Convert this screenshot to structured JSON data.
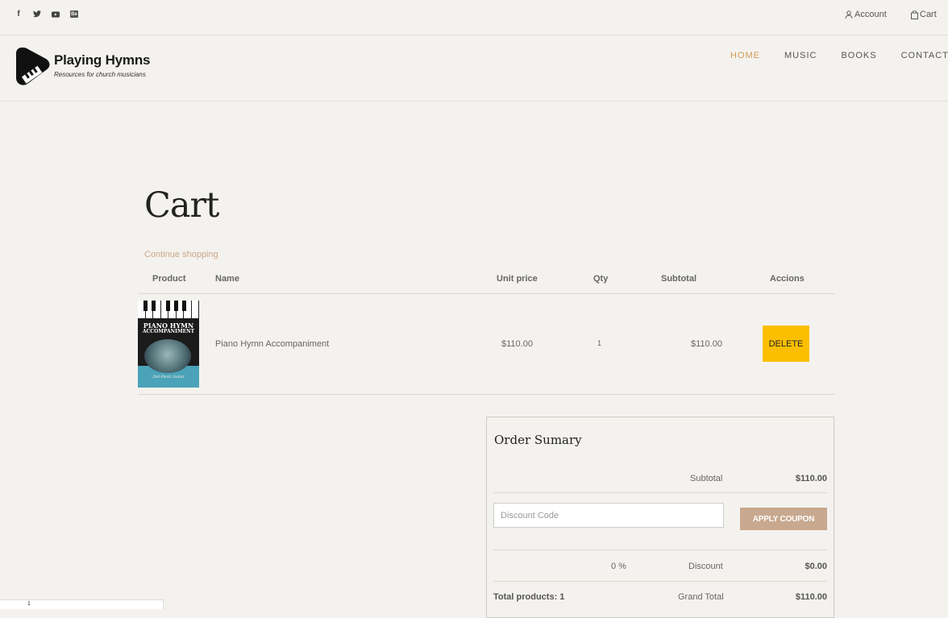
{
  "topbar": {
    "social": [
      "facebook-icon",
      "twitter-icon",
      "youtube-icon",
      "behance-icon"
    ],
    "behance_text": "Be",
    "account_label": "Account",
    "cart_label": "Cart"
  },
  "header": {
    "logo_title": "Playing Hymns",
    "logo_subtitle": "Resources for church musicians",
    "nav": [
      {
        "label": "HOME",
        "active": true
      },
      {
        "label": "MUSIC",
        "active": false
      },
      {
        "label": "BOOKS",
        "active": false
      },
      {
        "label": "CONTACT",
        "active": false
      }
    ],
    "accent_color": "#d29a55"
  },
  "page": {
    "title": "Cart",
    "continue_label": "Continue shopping"
  },
  "table": {
    "headers": [
      "Product",
      "Name",
      "Unit price",
      "Qty",
      "Subtotal",
      "Accions"
    ],
    "items": [
      {
        "cover_title_1": "PIANO HYMN",
        "cover_title_2": "ACCOMPANIMENT",
        "cover_author": "Joel Alevis Juarez",
        "name": "Piano Hymn Accompaniment",
        "unit_price": "$110.00",
        "qty": "1",
        "subtotal": "$110.00",
        "action_label": "DELETE"
      }
    ],
    "delete_color": "#fbbf00"
  },
  "summary": {
    "title": "Order Sumary",
    "subtotal_label": "Subtotal",
    "subtotal_value": "$110.00",
    "discount_placeholder": "Discount Code",
    "coupon_label": "APPLY COUPON",
    "discount_percent": "0 %",
    "discount_label": "Discount",
    "discount_value": "$0.00",
    "total_products": "Total products: 1",
    "grand_total_label": "Grand Total",
    "grand_total_value": "$110.00",
    "coupon_color": "#c8a88e"
  },
  "footer_widget": {
    "text": "1"
  }
}
